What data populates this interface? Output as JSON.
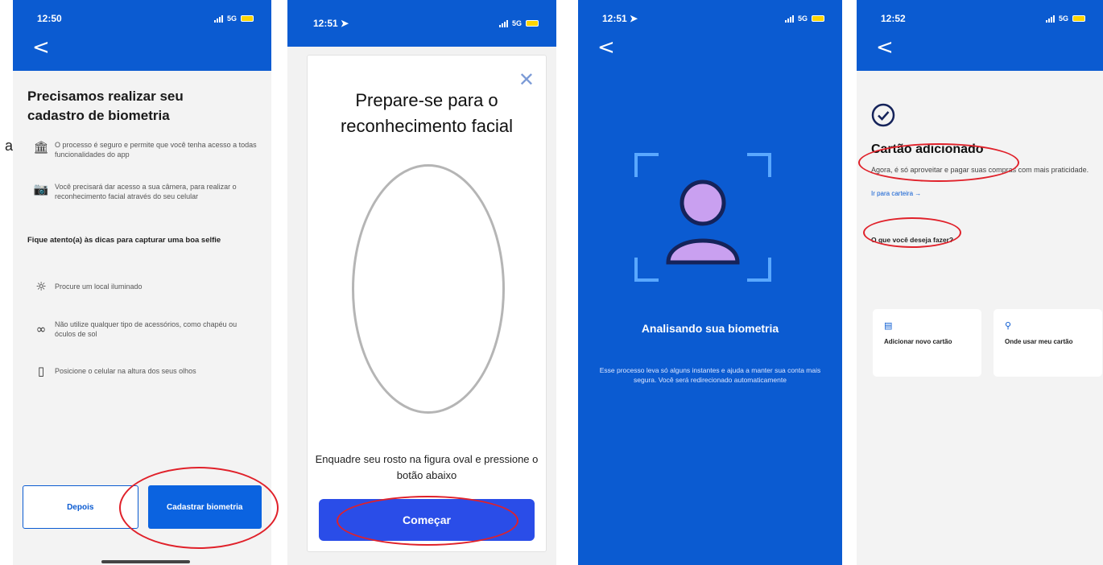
{
  "stray_char": "a",
  "screen1": {
    "time": "12:50",
    "network": "5G",
    "back": "<",
    "title": "Precisamos realizar seu cadastro de biometria",
    "info_items": [
      {
        "icon": "building-lock-icon",
        "glyph": "🏛",
        "text": "O processo é seguro e permite que você tenha acesso a todas funcionalidades do app"
      },
      {
        "icon": "camera-icon",
        "glyph": "📷",
        "text": "Você precisará dar acesso a sua câmera, para realizar o reconhecimento facial através do seu celular"
      }
    ],
    "tips_title": "Fique atento(a) às dicas para capturar uma boa selfie",
    "tips": [
      {
        "icon": "sun-icon",
        "glyph": "☼",
        "text": "Procure um local iluminado"
      },
      {
        "icon": "glasses-icon",
        "glyph": "∞",
        "text": "Não utilize qualquer tipo de acessórios, como chapéu ou óculos de sol"
      },
      {
        "icon": "phone-icon",
        "glyph": "▯",
        "text": "Posicione o celular na altura dos seus olhos"
      }
    ],
    "later_label": "Depois",
    "register_label": "Cadastrar biometria"
  },
  "screen2": {
    "time": "12:51",
    "network": "5G",
    "close": "✕",
    "title": "Prepare-se para o reconhecimento facial",
    "caption": "Enquadre seu rosto na figura oval e pressione o botão abaixo",
    "start_label": "Começar"
  },
  "screen3": {
    "time": "12:51",
    "network": "5G",
    "back": "<",
    "title": "Analisando sua biometria",
    "description": "Esse processo leva só alguns instantes e ajuda a manter sua conta mais segura. Você será redirecionado automaticamente"
  },
  "screen4": {
    "time": "12:52",
    "network": "5G",
    "back": "<",
    "title": "Cartão adicionado",
    "description": "Agora, é só aproveitar e pagar suas compras com mais praticidade.",
    "wallet_link": "Ir para carteira →",
    "question": "O que você deseja fazer?",
    "tiles": [
      {
        "icon": "card-icon",
        "glyph": "▤",
        "label": "Adicionar novo cartão"
      },
      {
        "icon": "location-pin-icon",
        "glyph": "⚲",
        "label": "Onde usar meu cartão"
      }
    ]
  },
  "colors": {
    "primary_blue": "#0b5bd1",
    "button_blue": "#2a4de8",
    "highlight_red": "#e0212a",
    "accent_yellow": "#ffd400",
    "avatar_purple": "#c9a0f0"
  }
}
